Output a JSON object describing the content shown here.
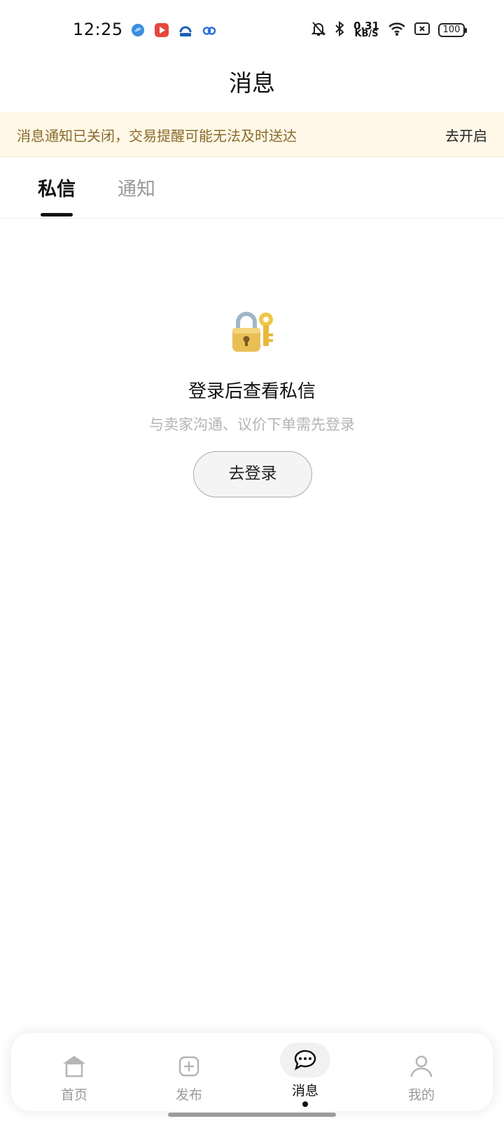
{
  "status_bar": {
    "time": "12:25",
    "net_speed_value": "0.31",
    "net_speed_unit": "KB/S",
    "battery": "100"
  },
  "header": {
    "title": "消息"
  },
  "notice": {
    "text": "消息通知已关闭，交易提醒可能无法及时送达",
    "action": "去开启"
  },
  "tabs": [
    {
      "label": "私信",
      "active": true
    },
    {
      "label": "通知",
      "active": false
    }
  ],
  "empty_state": {
    "title": "登录后查看私信",
    "subtitle": "与卖家沟通、议价下单需先登录",
    "button": "去登录"
  },
  "bottom_nav": [
    {
      "label": "首页",
      "icon": "home-icon"
    },
    {
      "label": "发布",
      "icon": "publish-icon"
    },
    {
      "label": "消息",
      "icon": "message-icon",
      "active": true
    },
    {
      "label": "我的",
      "icon": "profile-icon"
    }
  ]
}
